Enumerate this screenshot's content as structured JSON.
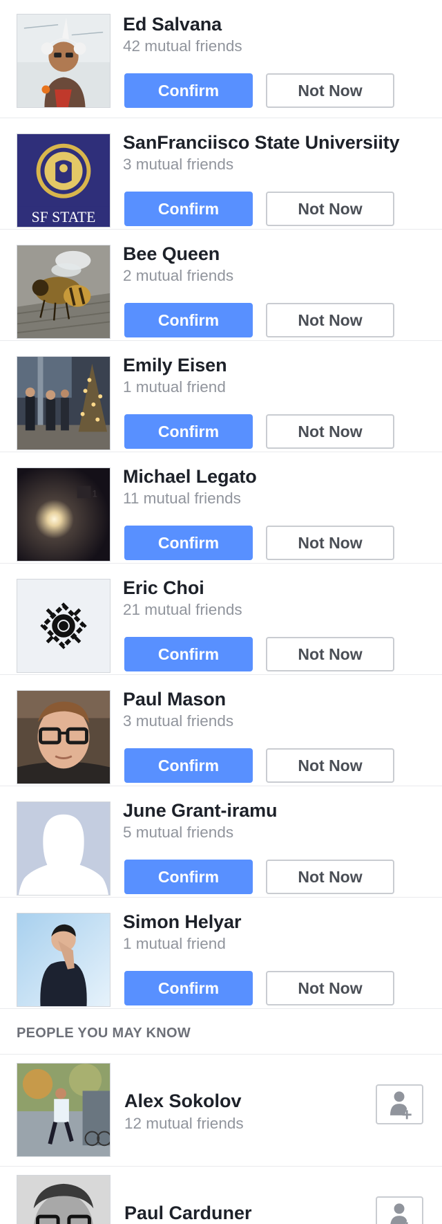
{
  "requests": [
    {
      "name": "Ed Salvana",
      "mutual": "42 mutual friends",
      "avatar_icon": "profile-photo-ed-salvana-icon",
      "confirm": "Confirm",
      "not_now": "Not Now"
    },
    {
      "name": "SanFranciisco State Universiity",
      "mutual": "3 mutual friends",
      "avatar_icon": "sf-state-logo-icon",
      "avatar_text": "SF STATE",
      "confirm": "Confirm",
      "not_now": "Not Now"
    },
    {
      "name": "Bee Queen",
      "mutual": "2 mutual friends",
      "avatar_icon": "bee-photo-icon",
      "confirm": "Confirm",
      "not_now": "Not Now"
    },
    {
      "name": "Emily Eisen",
      "mutual": "1 mutual friend",
      "avatar_icon": "party-photo-icon",
      "confirm": "Confirm",
      "not_now": "Not Now"
    },
    {
      "name": "Michael Legato",
      "mutual": "11 mutual friends",
      "avatar_icon": "light-photo-icon",
      "confirm": "Confirm",
      "not_now": "Not Now"
    },
    {
      "name": "Eric Choi",
      "mutual": "21 mutual friends",
      "avatar_icon": "geometric-logo-icon",
      "confirm": "Confirm",
      "not_now": "Not Now"
    },
    {
      "name": "Paul Mason",
      "mutual": "3 mutual friends",
      "avatar_icon": "profile-photo-paul-mason-icon",
      "confirm": "Confirm",
      "not_now": "Not Now"
    },
    {
      "name": "June Grant-iramu",
      "mutual": "5 mutual friends",
      "avatar_icon": "default-female-avatar-icon",
      "confirm": "Confirm",
      "not_now": "Not Now"
    },
    {
      "name": "Simon Helyar",
      "mutual": "1 mutual friend",
      "avatar_icon": "profile-photo-simon-helyar-icon",
      "confirm": "Confirm",
      "not_now": "Not Now"
    }
  ],
  "pymk": {
    "header": "PEOPLE YOU MAY KNOW",
    "people": [
      {
        "name": "Alex Sokolov",
        "mutual": "12 mutual friends",
        "avatar_icon": "runner-photo-icon",
        "add_icon": "add-friend-icon"
      },
      {
        "name": "Paul Carduner",
        "mutual": "",
        "avatar_icon": "profile-photo-paul-carduner-icon",
        "add_icon": "add-friend-icon"
      }
    ]
  },
  "colors": {
    "confirm_bg": "#5890ff",
    "not_now_border": "#c9ccd1",
    "name_text": "#1d2129",
    "secondary_text": "#90949c",
    "divider": "#e9eaed"
  }
}
